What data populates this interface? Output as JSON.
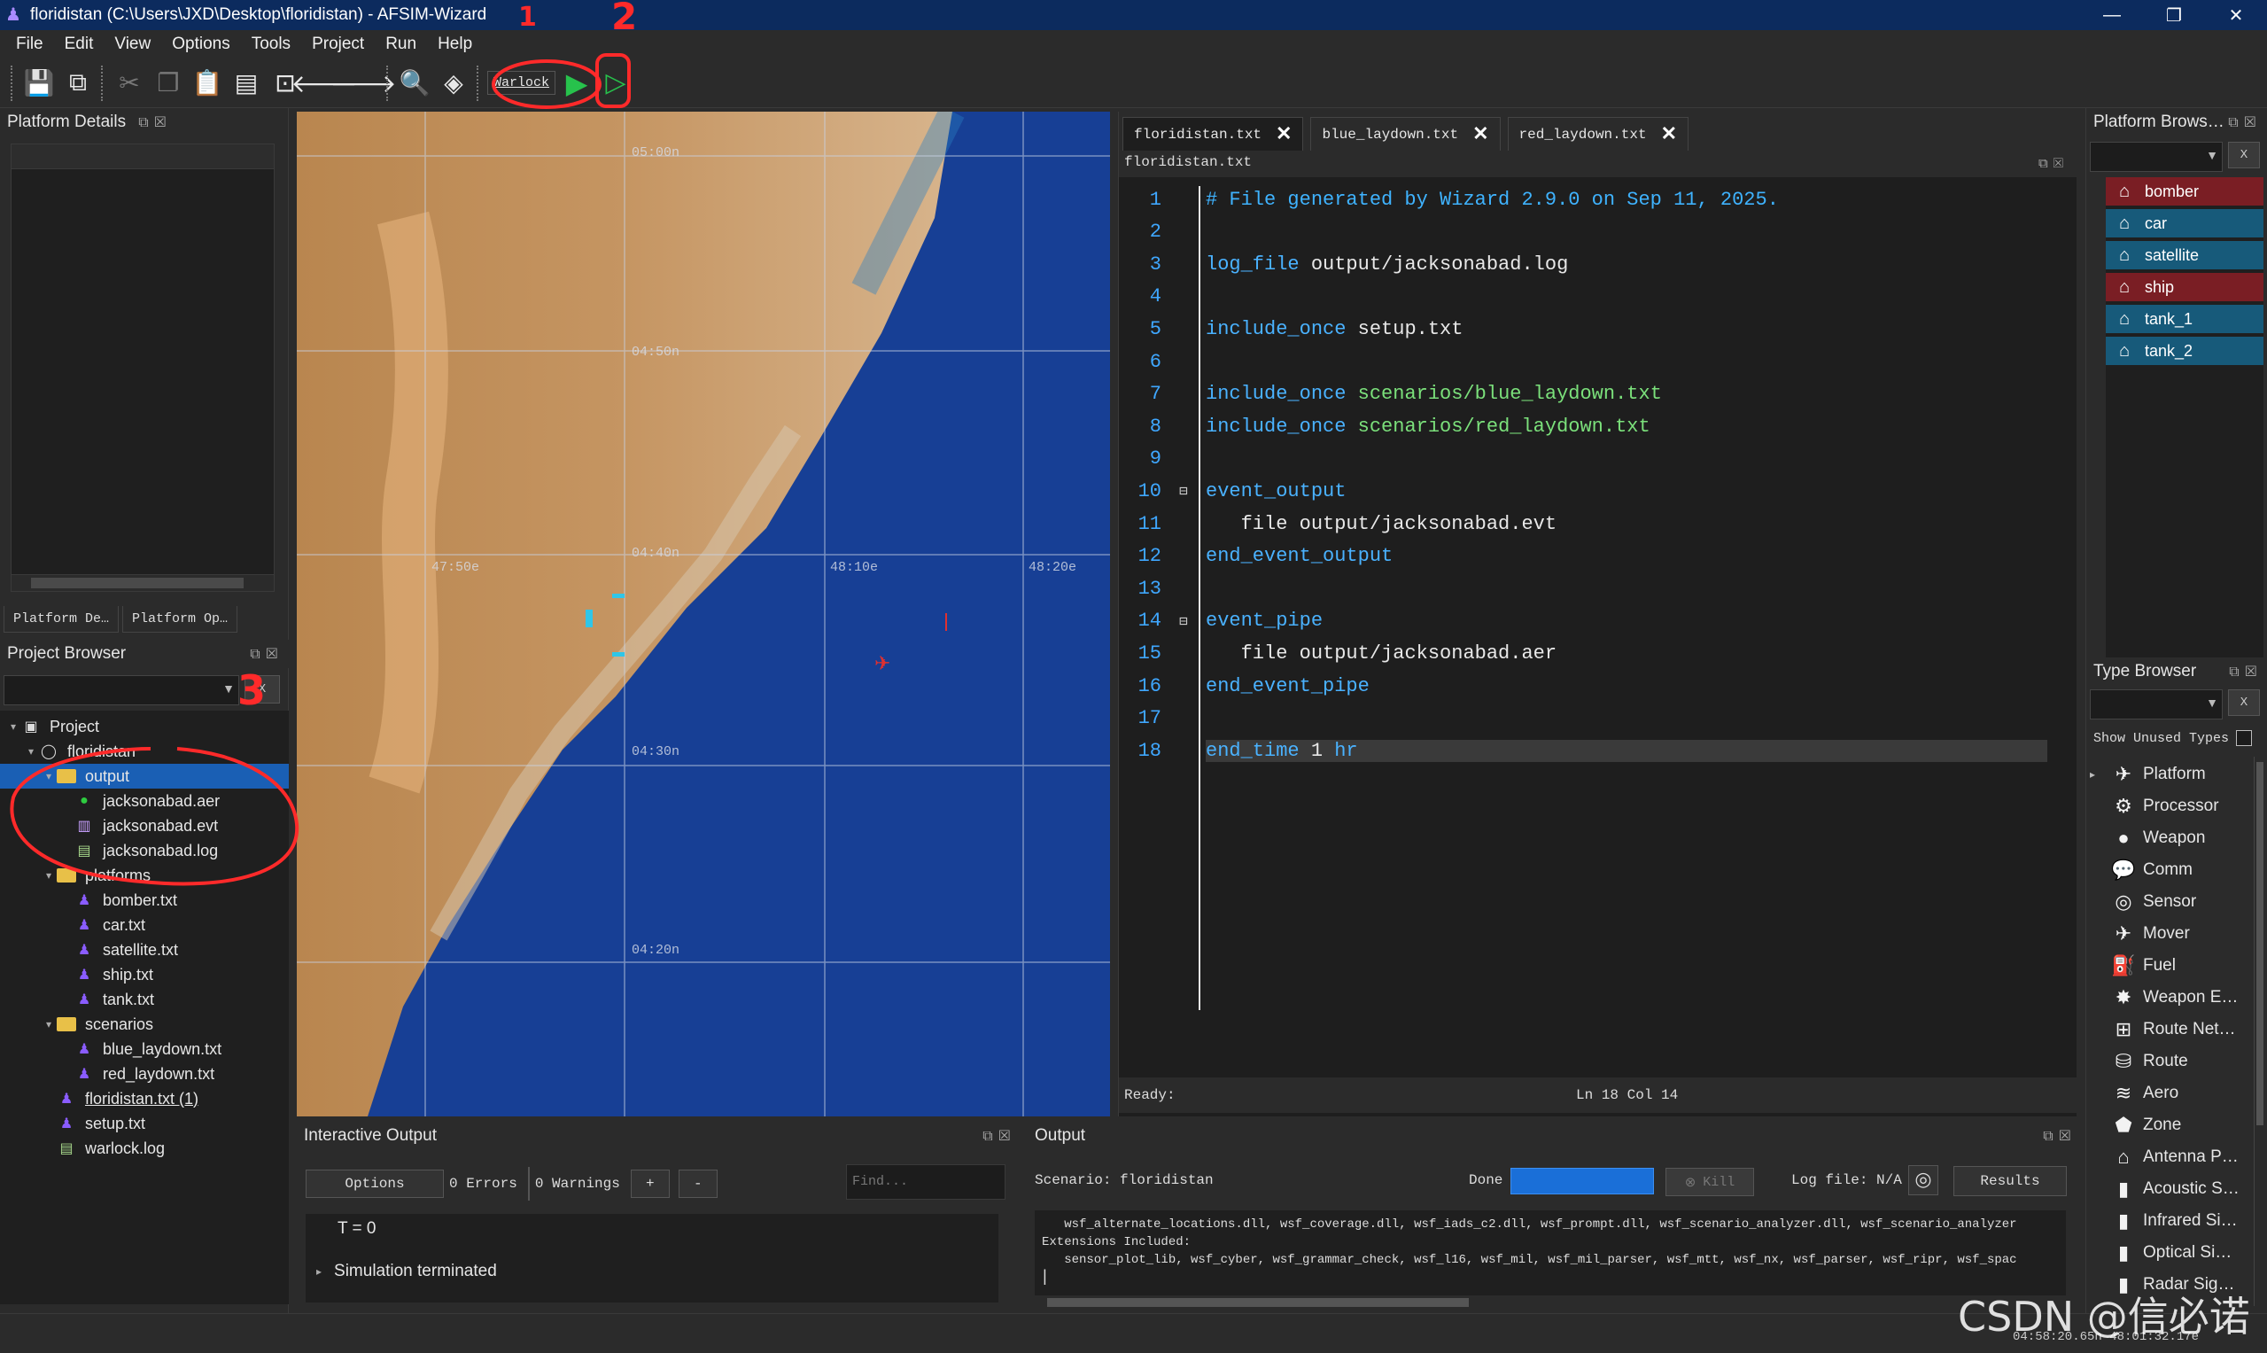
{
  "window": {
    "title": "floridistan (C:\\Users\\JXD\\Desktop\\floridistan) - AFSIM-Wizard",
    "controls": [
      "—",
      "❐",
      "✕"
    ]
  },
  "menu": [
    "File",
    "Edit",
    "View",
    "Options",
    "Tools",
    "Project",
    "Run",
    "Help"
  ],
  "toolbar": {
    "warlock_label": "Warlock"
  },
  "platform_details": {
    "title": "Platform Details",
    "tabs": [
      "Platform De…",
      "Platform Op…"
    ]
  },
  "project_browser": {
    "title": "Project Browser",
    "clear_label": "X",
    "tree": [
      {
        "label": "Project",
        "icon": "project-icon",
        "depth": 0,
        "expander": "▾"
      },
      {
        "label": "floridistan",
        "icon": "circle-icon",
        "depth": 1,
        "expander": "▾"
      },
      {
        "label": "output",
        "icon": "folder-icon",
        "depth": 2,
        "expander": "▾",
        "selected": true
      },
      {
        "label": "jacksonabad.aer",
        "icon": "green-ball-icon",
        "depth": 3,
        "expander": ""
      },
      {
        "label": "jacksonabad.evt",
        "icon": "event-file-icon",
        "depth": 3,
        "expander": ""
      },
      {
        "label": "jacksonabad.log",
        "icon": "log-file-icon",
        "depth": 3,
        "expander": ""
      },
      {
        "label": "platforms",
        "icon": "folder-icon",
        "depth": 2,
        "expander": "▾"
      },
      {
        "label": "bomber.txt",
        "icon": "wizard-hat-icon",
        "depth": 3,
        "expander": ""
      },
      {
        "label": "car.txt",
        "icon": "wizard-hat-icon",
        "depth": 3,
        "expander": ""
      },
      {
        "label": "satellite.txt",
        "icon": "wizard-hat-icon",
        "depth": 3,
        "expander": ""
      },
      {
        "label": "ship.txt",
        "icon": "wizard-hat-icon",
        "depth": 3,
        "expander": ""
      },
      {
        "label": "tank.txt",
        "icon": "wizard-hat-icon",
        "depth": 3,
        "expander": ""
      },
      {
        "label": "scenarios",
        "icon": "folder-icon",
        "depth": 2,
        "expander": "▾"
      },
      {
        "label": "blue_laydown.txt",
        "icon": "wizard-hat-icon",
        "depth": 3,
        "expander": ""
      },
      {
        "label": "red_laydown.txt",
        "icon": "wizard-hat-icon",
        "depth": 3,
        "expander": ""
      },
      {
        "label": "floridistan.txt (1)",
        "icon": "wizard-hat-icon",
        "depth": 2,
        "expander": "",
        "underline": true
      },
      {
        "label": "setup.txt",
        "icon": "wizard-hat-icon",
        "depth": 2,
        "expander": ""
      },
      {
        "label": "warlock.log",
        "icon": "log-file-icon",
        "depth": 2,
        "expander": ""
      }
    ]
  },
  "map": {
    "lat_labels": [
      "05:00n",
      "04:50n",
      "04:40n",
      "04:30n",
      "04:20n"
    ],
    "lon_labels": [
      "47:50e",
      "48:10e",
      "48:20e"
    ],
    "colors": {
      "sea": "#1a48a0",
      "land": "#c08a55",
      "platform_blue": "#2fc6e8",
      "platform_red": "#e03030"
    }
  },
  "editor": {
    "tabs": [
      {
        "label": "floridistan.txt",
        "active": true
      },
      {
        "label": "blue_laydown.txt",
        "active": false
      },
      {
        "label": "red_laydown.txt",
        "active": false
      }
    ],
    "path": "floridistan.txt",
    "lines": [
      {
        "n": "1",
        "fold": "",
        "parts": [
          {
            "t": "# File generated by Wizard 2.9.0 on Sep 11, 2025.",
            "c": "c-comment"
          }
        ]
      },
      {
        "n": "2",
        "fold": "",
        "parts": []
      },
      {
        "n": "3",
        "fold": "",
        "parts": [
          {
            "t": "log_file",
            "c": "c-key"
          },
          {
            "t": " output/jacksonabad.log",
            "c": "c-val"
          }
        ]
      },
      {
        "n": "4",
        "fold": "",
        "parts": []
      },
      {
        "n": "5",
        "fold": "",
        "parts": [
          {
            "t": "include_once",
            "c": "c-key"
          },
          {
            "t": " setup.txt",
            "c": "c-val"
          }
        ]
      },
      {
        "n": "6",
        "fold": "",
        "parts": []
      },
      {
        "n": "7",
        "fold": "",
        "parts": [
          {
            "t": "include_once",
            "c": "c-key"
          },
          {
            "t": " scenarios/blue_laydown.txt",
            "c": "c-green"
          }
        ]
      },
      {
        "n": "8",
        "fold": "",
        "parts": [
          {
            "t": "include_once",
            "c": "c-key"
          },
          {
            "t": " scenarios/red_laydown.txt",
            "c": "c-green"
          }
        ]
      },
      {
        "n": "9",
        "fold": "",
        "parts": []
      },
      {
        "n": "10",
        "fold": "⊟",
        "parts": [
          {
            "t": "event_output",
            "c": "c-key"
          }
        ]
      },
      {
        "n": "11",
        "fold": "",
        "parts": [
          {
            "t": "   file",
            "c": "c-val"
          },
          {
            "t": " output/jacksonabad.evt",
            "c": "c-val"
          }
        ]
      },
      {
        "n": "12",
        "fold": "",
        "parts": [
          {
            "t": "end_event_output",
            "c": "c-key"
          }
        ]
      },
      {
        "n": "13",
        "fold": "",
        "parts": []
      },
      {
        "n": "14",
        "fold": "⊟",
        "parts": [
          {
            "t": "event_pipe",
            "c": "c-key"
          }
        ]
      },
      {
        "n": "15",
        "fold": "",
        "parts": [
          {
            "t": "   file",
            "c": "c-val"
          },
          {
            "t": " output/jacksonabad.aer",
            "c": "c-val"
          }
        ]
      },
      {
        "n": "16",
        "fold": "",
        "parts": [
          {
            "t": "end_event_pipe",
            "c": "c-key"
          }
        ]
      },
      {
        "n": "17",
        "fold": "",
        "parts": []
      },
      {
        "n": "18",
        "fold": "",
        "current": true,
        "parts": [
          {
            "t": "end_time",
            "c": "c-key"
          },
          {
            "t": " 1 ",
            "c": "c-val"
          },
          {
            "t": "hr",
            "c": "c-key"
          }
        ]
      }
    ],
    "status_left": "Ready:",
    "status_pos": "Ln 18  Col 14"
  },
  "platform_browser": {
    "title": "Platform Brows…",
    "clear_label": "X",
    "platforms": [
      {
        "label": "bomber",
        "color": "#7a1e24"
      },
      {
        "label": "car",
        "color": "#175a7a"
      },
      {
        "label": "satellite",
        "color": "#175a7a"
      },
      {
        "label": "ship",
        "color": "#7a1e24"
      },
      {
        "label": "tank_1",
        "color": "#175a7a"
      },
      {
        "label": "tank_2",
        "color": "#175a7a"
      }
    ]
  },
  "type_browser": {
    "title": "Type Browser",
    "clear_label": "X",
    "show_unused": "Show Unused Types",
    "types": [
      {
        "label": "Platform",
        "icon": "airplane-icon",
        "glyph": "✈",
        "expander": "▸"
      },
      {
        "label": "Processor",
        "icon": "gears-icon",
        "glyph": "⚙",
        "expander": ""
      },
      {
        "label": "Weapon",
        "icon": "bomb-icon",
        "glyph": "●",
        "expander": ""
      },
      {
        "label": "Comm",
        "icon": "speech-bubble-icon",
        "glyph": "💬",
        "expander": ""
      },
      {
        "label": "Sensor",
        "icon": "radar-dish-icon",
        "glyph": "◎",
        "expander": ""
      },
      {
        "label": "Mover",
        "icon": "jet-icon",
        "glyph": "✈",
        "expander": ""
      },
      {
        "label": "Fuel",
        "icon": "fuel-pump-icon",
        "glyph": "⛽",
        "expander": ""
      },
      {
        "label": "Weapon E…",
        "icon": "explosion-icon",
        "glyph": "✸",
        "expander": ""
      },
      {
        "label": "Route Net…",
        "icon": "network-icon",
        "glyph": "⊞",
        "expander": ""
      },
      {
        "label": "Route",
        "icon": "route-icon",
        "glyph": "⛁",
        "expander": ""
      },
      {
        "label": "Aero",
        "icon": "wing-icon",
        "glyph": "≋",
        "expander": ""
      },
      {
        "label": "Zone",
        "icon": "pentagon-icon",
        "glyph": "⬟",
        "expander": ""
      },
      {
        "label": "Antenna P…",
        "icon": "house-icon",
        "glyph": "⌂",
        "expander": ""
      },
      {
        "label": "Acoustic S…",
        "icon": "bars-icon",
        "glyph": "▮",
        "expander": ""
      },
      {
        "label": "Infrared Si…",
        "icon": "bars-icon",
        "glyph": "▮",
        "expander": ""
      },
      {
        "label": "Optical Si…",
        "icon": "bars-icon",
        "glyph": "▮",
        "expander": ""
      },
      {
        "label": "Radar Sig…",
        "icon": "bars-icon",
        "glyph": "▮",
        "expander": ""
      }
    ]
  },
  "interactive_output": {
    "title": "Interactive Output",
    "options_label": "Options",
    "errors_label": "0 Errors",
    "warnings_label": "0 Warnings",
    "plus_label": "+",
    "minus_label": "-",
    "find_placeholder": "Find...",
    "lines": [
      "T = 0",
      "Simulation terminated"
    ]
  },
  "output": {
    "title": "Output",
    "scenario": "Scenario: floridistan",
    "done_label": "Done",
    "progress": 1.0,
    "kill_label": "Kill",
    "log_file": "Log file: N/A",
    "results_label": "Results",
    "lines": [
      "   wsf_alternate_locations.dll, wsf_coverage.dll, wsf_iads_c2.dll, wsf_prompt.dll, wsf_scenario_analyzer.dll, wsf_scenario_analyzer",
      "Extensions Included:",
      "   sensor_plot_lib, wsf_cyber, wsf_grammar_check, wsf_l16, wsf_mil, wsf_mil_parser, wsf_mtt, wsf_nx, wsf_parser, wsf_ripr, wsf_spac"
    ]
  },
  "statusbar": {
    "coords": "04:58:20.65n  48:01:32.17e"
  },
  "annotations": {
    "one": "1",
    "two": "2",
    "three": "3"
  },
  "watermark": "CSDN @信必诺"
}
